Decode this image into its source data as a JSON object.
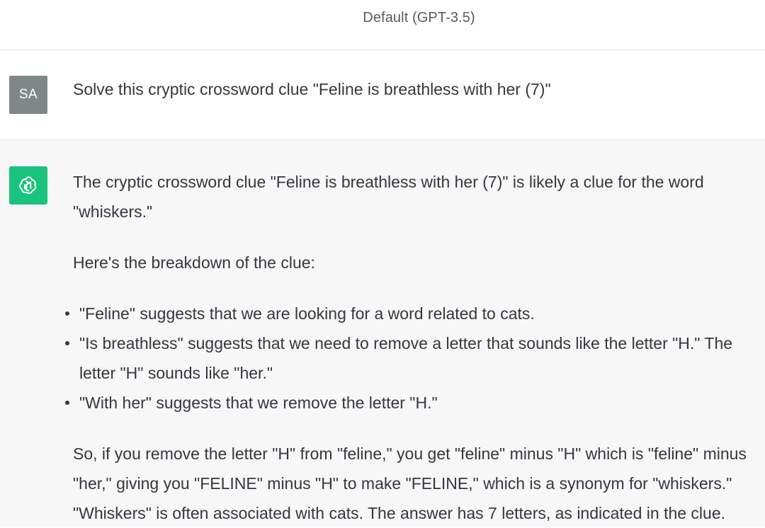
{
  "header": {
    "model_label": "Default (GPT-3.5)"
  },
  "user": {
    "avatar_initials": "SA",
    "avatar_color": "#7e8888",
    "message": "Solve this cryptic crossword clue \"Feline is breathless with her (7)\""
  },
  "assistant": {
    "avatar_icon": "openai-logo-icon",
    "avatar_color": "#19c37d",
    "intro_line1": "The cryptic crossword clue \"Feline is breathless with her (7)\" is likely a clue for the word",
    "intro_line2": "\"whiskers.\"",
    "breakdown_heading": "Here's the breakdown of the clue:",
    "bullets": [
      {
        "line1": "\"Feline\" suggests that we are looking for a word related to cats.",
        "line2": ""
      },
      {
        "line1": "\"Is breathless\" suggests that we need to remove a letter that sounds like the letter \"H.\" The",
        "line2": "letter \"H\" sounds like \"her.\""
      },
      {
        "line1": "\"With her\" suggests that we remove the letter \"H.\"",
        "line2": ""
      }
    ],
    "conclusion_line1": "So, if you remove the letter \"H\" from \"feline,\" you get \"feline\" minus \"H\" which is \"feline\" minus",
    "conclusion_line2": "\"her,\" giving you \"FELINE\" minus \"H\" to make \"FELINE,\" which is a synonym for \"whiskers.\"",
    "conclusion_line3": "\"Whiskers\" is often associated with cats. The answer has 7 letters, as indicated in the clue."
  }
}
